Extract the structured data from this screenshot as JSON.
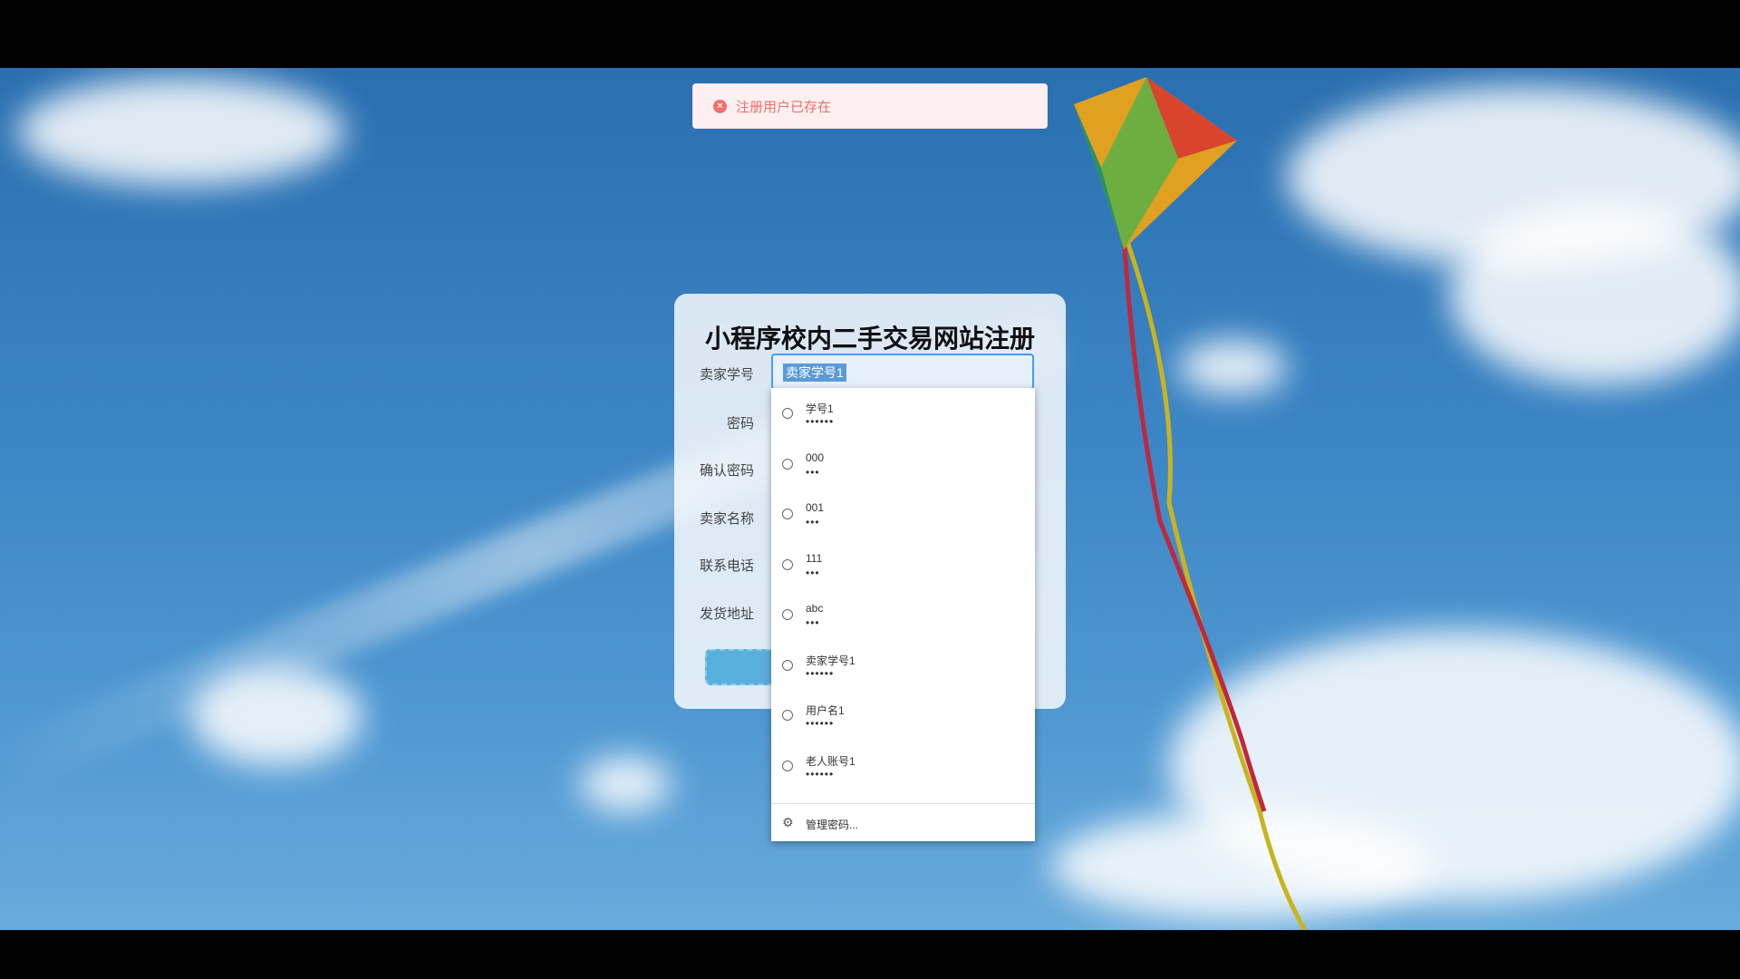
{
  "toast": {
    "icon": "error-circle-icon",
    "message": "注册用户已存在",
    "color": "#f56c6c"
  },
  "form": {
    "title": "小程序校内二手交易网站注册",
    "labels": [
      "卖家学号",
      "密码",
      "确认密码",
      "卖家名称",
      "联系电话",
      "发货地址"
    ],
    "student_id_value": "卖家学号1"
  },
  "autocomplete": {
    "items": [
      {
        "user": "学号1",
        "pass": "••••••"
      },
      {
        "user": "000",
        "pass": "•••"
      },
      {
        "user": "001",
        "pass": "•••"
      },
      {
        "user": "111",
        "pass": "•••"
      },
      {
        "user": "abc",
        "pass": "•••"
      },
      {
        "user": "卖家学号1",
        "pass": "••••••"
      },
      {
        "user": "用户名1",
        "pass": "••••••"
      },
      {
        "user": "老人账号1",
        "pass": "••••••"
      }
    ],
    "manage_label": "管理密码..."
  }
}
